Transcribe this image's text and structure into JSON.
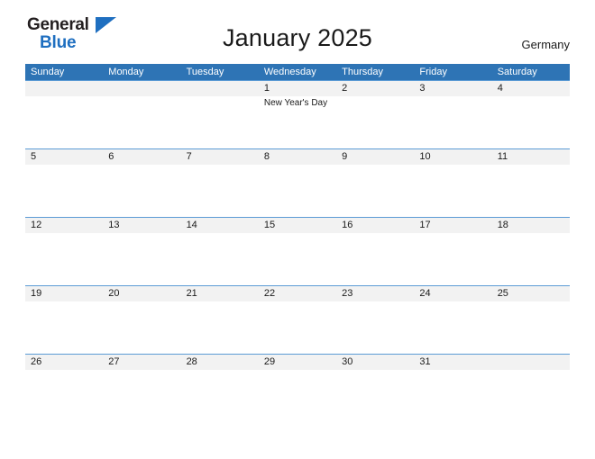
{
  "brand": {
    "line1": "General",
    "line2": "Blue",
    "triangle_icon": "triangle-right-icon",
    "color_dark": "#231f20",
    "color_blue": "#1f6fc0"
  },
  "header": {
    "title": "January 2025",
    "region": "Germany"
  },
  "theme": {
    "header_blue": "#2e74b5",
    "row_line_blue": "#5b9bd5",
    "band_gray": "#f2f2f2",
    "text": "#1a1a1a"
  },
  "calendar": {
    "weekdays": [
      "Sunday",
      "Monday",
      "Tuesday",
      "Wednesday",
      "Thursday",
      "Friday",
      "Saturday"
    ],
    "weeks": [
      {
        "days": [
          {
            "num": "",
            "event": ""
          },
          {
            "num": "",
            "event": ""
          },
          {
            "num": "",
            "event": ""
          },
          {
            "num": "1",
            "event": "New Year's Day"
          },
          {
            "num": "2",
            "event": ""
          },
          {
            "num": "3",
            "event": ""
          },
          {
            "num": "4",
            "event": ""
          }
        ]
      },
      {
        "days": [
          {
            "num": "5",
            "event": ""
          },
          {
            "num": "6",
            "event": ""
          },
          {
            "num": "7",
            "event": ""
          },
          {
            "num": "8",
            "event": ""
          },
          {
            "num": "9",
            "event": ""
          },
          {
            "num": "10",
            "event": ""
          },
          {
            "num": "11",
            "event": ""
          }
        ]
      },
      {
        "days": [
          {
            "num": "12",
            "event": ""
          },
          {
            "num": "13",
            "event": ""
          },
          {
            "num": "14",
            "event": ""
          },
          {
            "num": "15",
            "event": ""
          },
          {
            "num": "16",
            "event": ""
          },
          {
            "num": "17",
            "event": ""
          },
          {
            "num": "18",
            "event": ""
          }
        ]
      },
      {
        "days": [
          {
            "num": "19",
            "event": ""
          },
          {
            "num": "20",
            "event": ""
          },
          {
            "num": "21",
            "event": ""
          },
          {
            "num": "22",
            "event": ""
          },
          {
            "num": "23",
            "event": ""
          },
          {
            "num": "24",
            "event": ""
          },
          {
            "num": "25",
            "event": ""
          }
        ]
      },
      {
        "days": [
          {
            "num": "26",
            "event": ""
          },
          {
            "num": "27",
            "event": ""
          },
          {
            "num": "28",
            "event": ""
          },
          {
            "num": "29",
            "event": ""
          },
          {
            "num": "30",
            "event": ""
          },
          {
            "num": "31",
            "event": ""
          },
          {
            "num": "",
            "event": ""
          }
        ]
      }
    ]
  }
}
